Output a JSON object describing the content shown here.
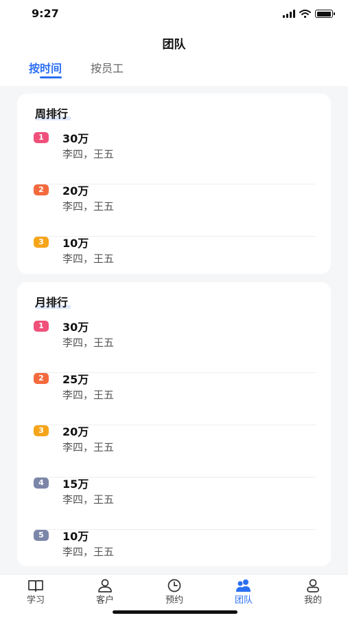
{
  "status_bar": {
    "time": "9:27"
  },
  "header": {
    "title": "团队"
  },
  "tabs": [
    {
      "label": "按时间",
      "active": true
    },
    {
      "label": "按员工",
      "active": false
    }
  ],
  "weekly": {
    "title": "周排行",
    "rows": [
      {
        "rank": "1",
        "amount": "30万",
        "names": "李四，王五",
        "badge_color": "#f0507a"
      },
      {
        "rank": "2",
        "amount": "20万",
        "names": "李四，王五",
        "badge_color": "#f36a3e"
      },
      {
        "rank": "3",
        "amount": "10万",
        "names": "李四，王五",
        "badge_color": "#f6a51b"
      }
    ]
  },
  "monthly": {
    "title": "月排行",
    "rows": [
      {
        "rank": "1",
        "amount": "30万",
        "names": "李四，王五",
        "badge_color": "#f0507a"
      },
      {
        "rank": "2",
        "amount": "25万",
        "names": "李四，王五",
        "badge_color": "#f36a3e"
      },
      {
        "rank": "3",
        "amount": "20万",
        "names": "李四，王五",
        "badge_color": "#f6a51b"
      },
      {
        "rank": "4",
        "amount": "15万",
        "names": "李四，王五",
        "badge_color": "#7c86a8"
      },
      {
        "rank": "5",
        "amount": "10万",
        "names": "李四，王五",
        "badge_color": "#7c86a8"
      }
    ]
  },
  "tabbar": [
    {
      "label": "学习",
      "icon": "book-icon",
      "active": false
    },
    {
      "label": "客户",
      "icon": "user-icon",
      "active": false
    },
    {
      "label": "预约",
      "icon": "clock-icon",
      "active": false
    },
    {
      "label": "团队",
      "icon": "team-icon",
      "active": true
    },
    {
      "label": "我的",
      "icon": "profile-icon",
      "active": false
    }
  ],
  "colors": {
    "accent": "#2b6ff3"
  }
}
